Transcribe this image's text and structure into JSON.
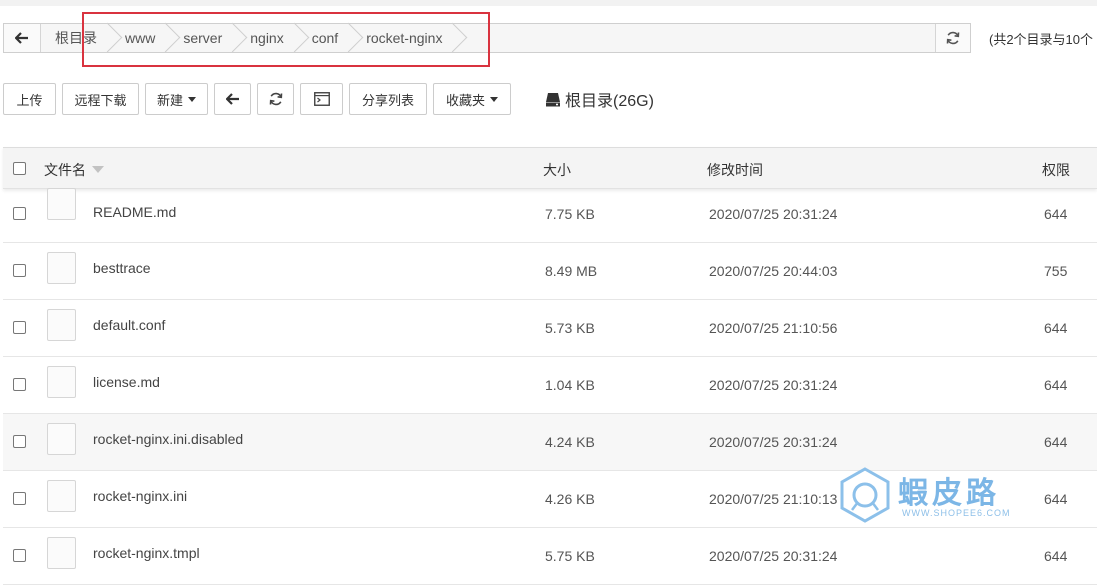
{
  "path": {
    "crumbs": [
      "根目录",
      "www",
      "server",
      "nginx",
      "conf",
      "rocket-nginx"
    ],
    "summary": "(共2个目录与10个"
  },
  "toolbar": {
    "upload": "上传",
    "remote_download": "远程下载",
    "new": "新建",
    "share_list": "分享列表",
    "favorites": "收藏夹",
    "disk": "根目录(26G)"
  },
  "table": {
    "headers": {
      "name": "文件名",
      "size": "大小",
      "modified": "修改时间",
      "permission": "权限"
    },
    "rows": [
      {
        "name": "README.md",
        "size": "7.75 KB",
        "modified": "2020/07/25 20:31:24",
        "permission": "644"
      },
      {
        "name": "besttrace",
        "size": "8.49 MB",
        "modified": "2020/07/25 20:44:03",
        "permission": "755"
      },
      {
        "name": "default.conf",
        "size": "5.73 KB",
        "modified": "2020/07/25 21:10:56",
        "permission": "644"
      },
      {
        "name": "license.md",
        "size": "1.04 KB",
        "modified": "2020/07/25 20:31:24",
        "permission": "644"
      },
      {
        "name": "rocket-nginx.ini.disabled",
        "size": "4.24 KB",
        "modified": "2020/07/25 20:31:24",
        "permission": "644"
      },
      {
        "name": "rocket-nginx.ini",
        "size": "4.26 KB",
        "modified": "2020/07/25 21:10:13",
        "permission": "644"
      },
      {
        "name": "rocket-nginx.tmpl",
        "size": "5.75 KB",
        "modified": "2020/07/25 20:31:24",
        "permission": "644"
      }
    ]
  },
  "watermark": {
    "title": "蝦皮路",
    "url": "WWW.SHOPEE6.COM"
  },
  "colors": {
    "highlight": "#d9333f",
    "watermark": "#7cb6e6"
  }
}
